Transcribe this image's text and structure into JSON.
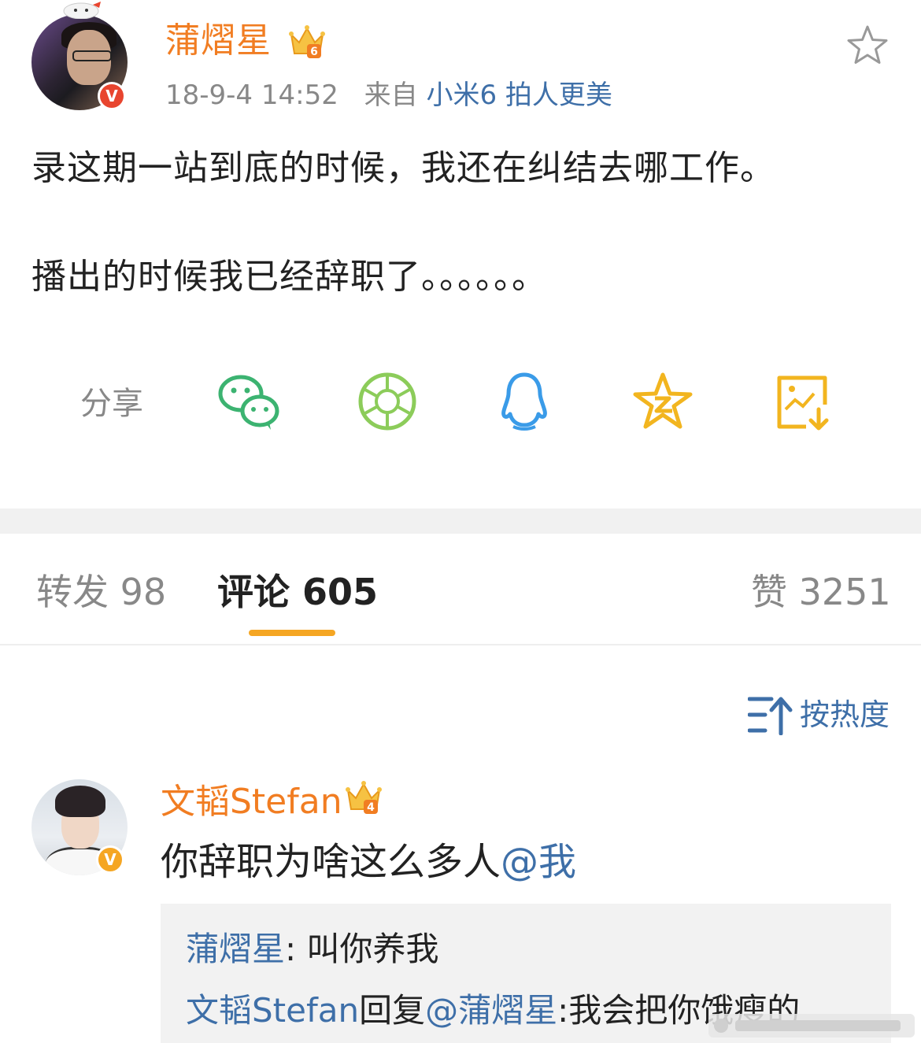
{
  "post": {
    "author": "蒲熠星",
    "timestamp": "18-9-4 14:52",
    "source_prefix": "来自",
    "source": "小米6 拍人更美",
    "paragraphs": [
      "录这期一站到底的时候，我还在纠结去哪工作。",
      "播出的时候我已经辞职了。。。。。。"
    ],
    "badge_mark": "V",
    "crown_level": "6"
  },
  "share": {
    "label": "分享",
    "targets": [
      "wechat-icon",
      "moments-icon",
      "qq-icon",
      "qzone-icon",
      "save-image-icon"
    ]
  },
  "tabs": [
    {
      "label": "转发 98"
    },
    {
      "label": "评论 605"
    },
    {
      "label": "赞 3251"
    }
  ],
  "sort": {
    "label": "按热度"
  },
  "comment": {
    "author": "文韬Stefan",
    "text": "你辞职为啥这么多人",
    "mention": "@我",
    "badge_mark": "V",
    "crown_level": "4",
    "replies": [
      {
        "name": "蒲熠星",
        "text": ": 叫你养我"
      },
      {
        "name": "文韬Stefan",
        "text": "回复",
        "mention": "@蒲熠星",
        "tail": ":我会把你饿瘦的"
      }
    ]
  },
  "colors": {
    "username_orange": "#f17d22",
    "link_blue": "#3e6fa8",
    "accent": "#f5a623",
    "verified_red": "#e8452f"
  }
}
